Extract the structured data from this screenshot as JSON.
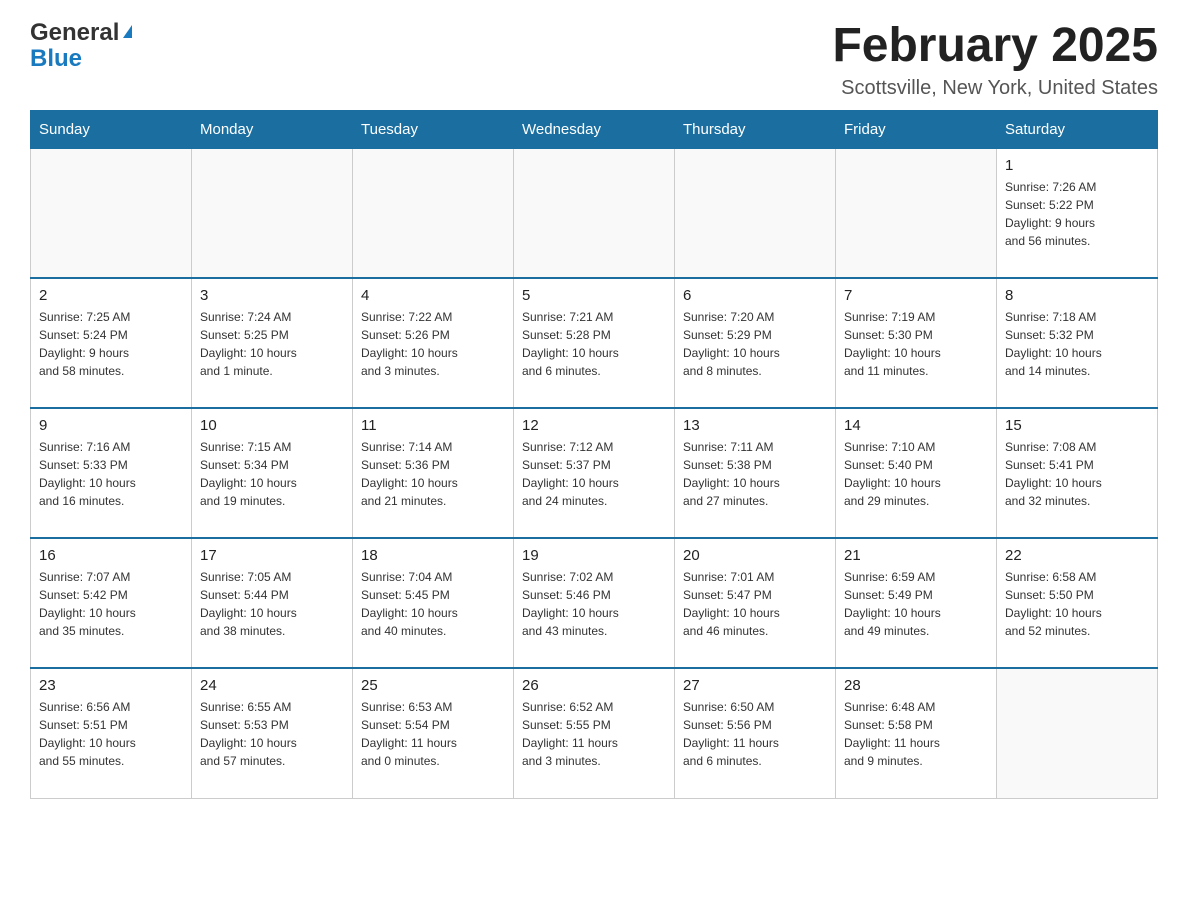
{
  "logo": {
    "general": "General",
    "blue": "Blue"
  },
  "title": "February 2025",
  "location": "Scottsville, New York, United States",
  "weekdays": [
    "Sunday",
    "Monday",
    "Tuesday",
    "Wednesday",
    "Thursday",
    "Friday",
    "Saturday"
  ],
  "weeks": [
    [
      {
        "day": "",
        "info": ""
      },
      {
        "day": "",
        "info": ""
      },
      {
        "day": "",
        "info": ""
      },
      {
        "day": "",
        "info": ""
      },
      {
        "day": "",
        "info": ""
      },
      {
        "day": "",
        "info": ""
      },
      {
        "day": "1",
        "info": "Sunrise: 7:26 AM\nSunset: 5:22 PM\nDaylight: 9 hours\nand 56 minutes."
      }
    ],
    [
      {
        "day": "2",
        "info": "Sunrise: 7:25 AM\nSunset: 5:24 PM\nDaylight: 9 hours\nand 58 minutes."
      },
      {
        "day": "3",
        "info": "Sunrise: 7:24 AM\nSunset: 5:25 PM\nDaylight: 10 hours\nand 1 minute."
      },
      {
        "day": "4",
        "info": "Sunrise: 7:22 AM\nSunset: 5:26 PM\nDaylight: 10 hours\nand 3 minutes."
      },
      {
        "day": "5",
        "info": "Sunrise: 7:21 AM\nSunset: 5:28 PM\nDaylight: 10 hours\nand 6 minutes."
      },
      {
        "day": "6",
        "info": "Sunrise: 7:20 AM\nSunset: 5:29 PM\nDaylight: 10 hours\nand 8 minutes."
      },
      {
        "day": "7",
        "info": "Sunrise: 7:19 AM\nSunset: 5:30 PM\nDaylight: 10 hours\nand 11 minutes."
      },
      {
        "day": "8",
        "info": "Sunrise: 7:18 AM\nSunset: 5:32 PM\nDaylight: 10 hours\nand 14 minutes."
      }
    ],
    [
      {
        "day": "9",
        "info": "Sunrise: 7:16 AM\nSunset: 5:33 PM\nDaylight: 10 hours\nand 16 minutes."
      },
      {
        "day": "10",
        "info": "Sunrise: 7:15 AM\nSunset: 5:34 PM\nDaylight: 10 hours\nand 19 minutes."
      },
      {
        "day": "11",
        "info": "Sunrise: 7:14 AM\nSunset: 5:36 PM\nDaylight: 10 hours\nand 21 minutes."
      },
      {
        "day": "12",
        "info": "Sunrise: 7:12 AM\nSunset: 5:37 PM\nDaylight: 10 hours\nand 24 minutes."
      },
      {
        "day": "13",
        "info": "Sunrise: 7:11 AM\nSunset: 5:38 PM\nDaylight: 10 hours\nand 27 minutes."
      },
      {
        "day": "14",
        "info": "Sunrise: 7:10 AM\nSunset: 5:40 PM\nDaylight: 10 hours\nand 29 minutes."
      },
      {
        "day": "15",
        "info": "Sunrise: 7:08 AM\nSunset: 5:41 PM\nDaylight: 10 hours\nand 32 minutes."
      }
    ],
    [
      {
        "day": "16",
        "info": "Sunrise: 7:07 AM\nSunset: 5:42 PM\nDaylight: 10 hours\nand 35 minutes."
      },
      {
        "day": "17",
        "info": "Sunrise: 7:05 AM\nSunset: 5:44 PM\nDaylight: 10 hours\nand 38 minutes."
      },
      {
        "day": "18",
        "info": "Sunrise: 7:04 AM\nSunset: 5:45 PM\nDaylight: 10 hours\nand 40 minutes."
      },
      {
        "day": "19",
        "info": "Sunrise: 7:02 AM\nSunset: 5:46 PM\nDaylight: 10 hours\nand 43 minutes."
      },
      {
        "day": "20",
        "info": "Sunrise: 7:01 AM\nSunset: 5:47 PM\nDaylight: 10 hours\nand 46 minutes."
      },
      {
        "day": "21",
        "info": "Sunrise: 6:59 AM\nSunset: 5:49 PM\nDaylight: 10 hours\nand 49 minutes."
      },
      {
        "day": "22",
        "info": "Sunrise: 6:58 AM\nSunset: 5:50 PM\nDaylight: 10 hours\nand 52 minutes."
      }
    ],
    [
      {
        "day": "23",
        "info": "Sunrise: 6:56 AM\nSunset: 5:51 PM\nDaylight: 10 hours\nand 55 minutes."
      },
      {
        "day": "24",
        "info": "Sunrise: 6:55 AM\nSunset: 5:53 PM\nDaylight: 10 hours\nand 57 minutes."
      },
      {
        "day": "25",
        "info": "Sunrise: 6:53 AM\nSunset: 5:54 PM\nDaylight: 11 hours\nand 0 minutes."
      },
      {
        "day": "26",
        "info": "Sunrise: 6:52 AM\nSunset: 5:55 PM\nDaylight: 11 hours\nand 3 minutes."
      },
      {
        "day": "27",
        "info": "Sunrise: 6:50 AM\nSunset: 5:56 PM\nDaylight: 11 hours\nand 6 minutes."
      },
      {
        "day": "28",
        "info": "Sunrise: 6:48 AM\nSunset: 5:58 PM\nDaylight: 11 hours\nand 9 minutes."
      },
      {
        "day": "",
        "info": ""
      }
    ]
  ]
}
